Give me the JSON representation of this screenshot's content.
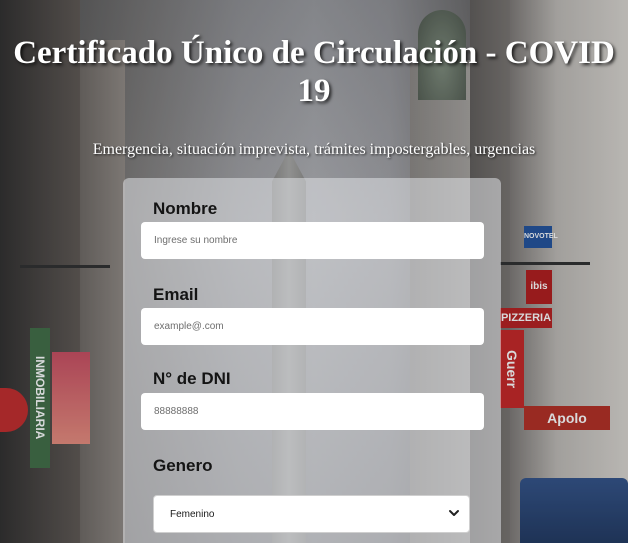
{
  "header": {
    "title": "Certificado Único de Circulación - COVID 19",
    "subtitle": "Emergencia, situación imprevista, trámites impostergables, urgencias"
  },
  "background": {
    "signs": {
      "pizzeria": "PIZZERIA",
      "guerrin": "Guerr",
      "ibis": "ibis",
      "apolo": "Apolo",
      "inmobiliaria": "INMOBILIARIA",
      "novotel": "NOVOTEL"
    }
  },
  "form": {
    "nombre": {
      "label": "Nombre",
      "placeholder": "Ingrese su nombre",
      "value": ""
    },
    "email": {
      "label": "Email",
      "placeholder": "example@.com",
      "value": ""
    },
    "dni": {
      "label": "N° de DNI",
      "placeholder": "88888888",
      "value": ""
    },
    "genero": {
      "label": "Genero",
      "selected": "Femenino",
      "icon": "chevron-down-icon"
    }
  },
  "colors": {
    "title_text": "#ffffff",
    "label_text": "#141414",
    "panel_bg": "rgba(224,226,230,0.55)"
  }
}
